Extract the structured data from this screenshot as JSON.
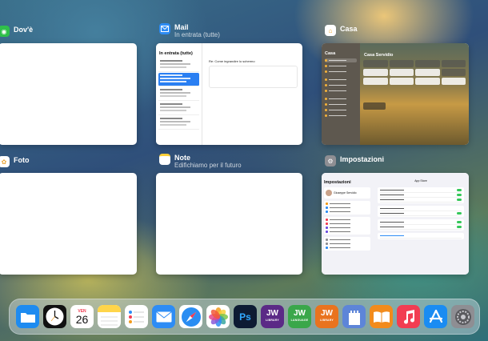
{
  "windows": {
    "dove": {
      "name": "Dov'è"
    },
    "mail": {
      "name": "Mail",
      "subtitle": "In entrata (tutte)",
      "preview": {
        "mailbox": "In entrata (tutte)",
        "subject": "Re: Come ingrandire lo schermo"
      }
    },
    "casa": {
      "name": "Casa",
      "preview": {
        "sidebar_title": "Casa",
        "home_name": "Casa Servidio"
      }
    },
    "foto": {
      "name": "Foto"
    },
    "note": {
      "name": "Note",
      "subtitle": "Edifichiamo per il futuro"
    },
    "impostazioni": {
      "name": "Impostazioni",
      "preview": {
        "sidebar_title": "Impostazioni",
        "profile_name": "Giuseppe Servidio",
        "main_title": "App Store"
      }
    }
  },
  "dock": {
    "calendar_day": "VEN",
    "calendar_date": "26",
    "apps": [
      {
        "name": "files-app",
        "color": "#1e8bf0"
      },
      {
        "name": "clock-app",
        "color": "#111111"
      },
      {
        "name": "calendar-app",
        "color": "#ffffff"
      },
      {
        "name": "notes-app",
        "color": "#ffd54a"
      },
      {
        "name": "reminders-app",
        "color": "#ffffff"
      },
      {
        "name": "mail-app",
        "color": "#2d8cf5"
      },
      {
        "name": "safari-app",
        "color": "#2a8df2"
      },
      {
        "name": "photos-app",
        "color": "#ffffff"
      },
      {
        "name": "photoshop-app",
        "color": "#0d1b33"
      },
      {
        "name": "jw-library-purple-app",
        "color": "#5b2a86"
      },
      {
        "name": "jw-language-app",
        "color": "#3aa74a"
      },
      {
        "name": "jw-library-orange-app",
        "color": "#e9731e"
      },
      {
        "name": "castle-app",
        "color": "#5d85d8"
      },
      {
        "name": "books-app",
        "color": "#f28b1c"
      },
      {
        "name": "music-app",
        "color": "#f23d52"
      },
      {
        "name": "app-store-app",
        "color": "#1a8cf2"
      },
      {
        "name": "settings-app",
        "color": "#8e8e93"
      }
    ],
    "labels": {
      "photoshop": "Ps",
      "jw_purple": "JW",
      "jw_purple_sub": "LIBRARY",
      "jw_green": "JW",
      "jw_green_sub": "LANGUAGE",
      "jw_orange": "JW",
      "jw_orange_sub": "LIBRARY"
    }
  }
}
